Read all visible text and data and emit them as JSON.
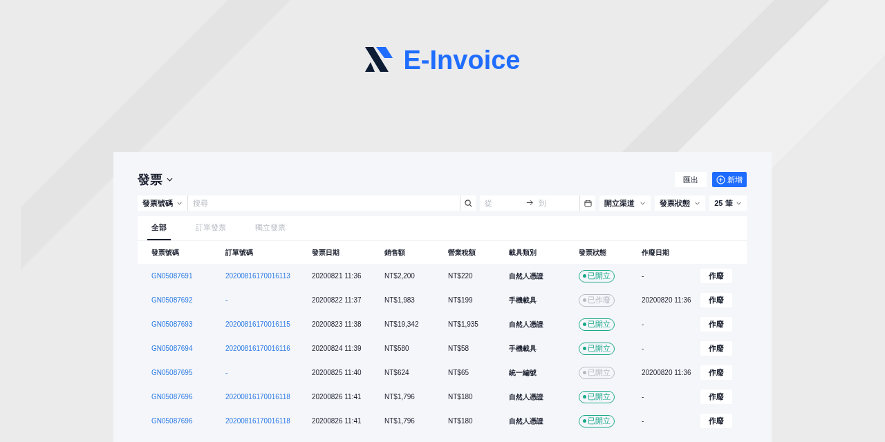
{
  "brand": {
    "name": "E-Invoice"
  },
  "page": {
    "title": "發票",
    "actions": [
      {
        "label": "匯出",
        "kind": "plain"
      },
      {
        "label": "新增",
        "kind": "primary"
      }
    ]
  },
  "filters": {
    "field_select": "發票號碼",
    "search": {
      "placeholder": "搜尋"
    },
    "date_from": {
      "placeholder": "從"
    },
    "date_to": {
      "placeholder": "到"
    },
    "dropdowns": [
      "開立渠道",
      "發票狀態",
      "25 筆"
    ]
  },
  "tabs": [
    {
      "label": "全部",
      "selected": true
    },
    {
      "label": "訂單發票",
      "selected": false
    },
    {
      "label": "獨立發票",
      "selected": false
    }
  ],
  "table": {
    "columns": [
      "發票號碼",
      "訂單號碼",
      "發票日期",
      "銷售額",
      "營業稅額",
      "載具類別",
      "發票狀態",
      "作廢日期"
    ],
    "rows": [
      {
        "invoice": "GN05087691",
        "order": "20200816170016113",
        "date": "20200821 11:36",
        "sales": "NT$2,200",
        "tax": "NT$220",
        "carrier": "自然人憑證",
        "status": "已開立",
        "active": true,
        "void_date": "-",
        "action": "作廢"
      },
      {
        "invoice": "GN05087692",
        "order": "-",
        "date": "20200822 11:37",
        "sales": "NT$1,983",
        "tax": "NT$199",
        "carrier": "手機載具",
        "status": "已作廢",
        "active": false,
        "void_date": "20200820 11:36",
        "action": "作廢"
      },
      {
        "invoice": "GN05087693",
        "order": "20200816170016115",
        "date": "20200823 11:38",
        "sales": "NT$19,342",
        "tax": "NT$1,935",
        "carrier": "自然人憑證",
        "status": "已開立",
        "active": true,
        "void_date": "-",
        "action": "作廢"
      },
      {
        "invoice": "GN05087694",
        "order": "20200816170016116",
        "date": "20200824 11:39",
        "sales": "NT$580",
        "tax": "NT$58",
        "carrier": "手機載具",
        "status": "已開立",
        "active": true,
        "void_date": "-",
        "action": "作廢"
      },
      {
        "invoice": "GN05087695",
        "order": "-",
        "date": "20200825 11:40",
        "sales": "NT$624",
        "tax": "NT$65",
        "carrier": "統一編號",
        "status": "已開立",
        "active": false,
        "void_date": "20200820 11:36",
        "action": "作廢"
      },
      {
        "invoice": "GN05087696",
        "order": "20200816170016118",
        "date": "20200826 11:41",
        "sales": "NT$1,796",
        "tax": "NT$180",
        "carrier": "自然人憑證",
        "status": "已開立",
        "active": true,
        "void_date": "-",
        "action": "作廢"
      },
      {
        "invoice": "GN05087696",
        "order": "20200816170016118",
        "date": "20200826 11:41",
        "sales": "NT$1,796",
        "tax": "NT$180",
        "carrier": "自然人憑證",
        "status": "已開立",
        "active": true,
        "void_date": "-",
        "action": "作廢"
      }
    ]
  }
}
